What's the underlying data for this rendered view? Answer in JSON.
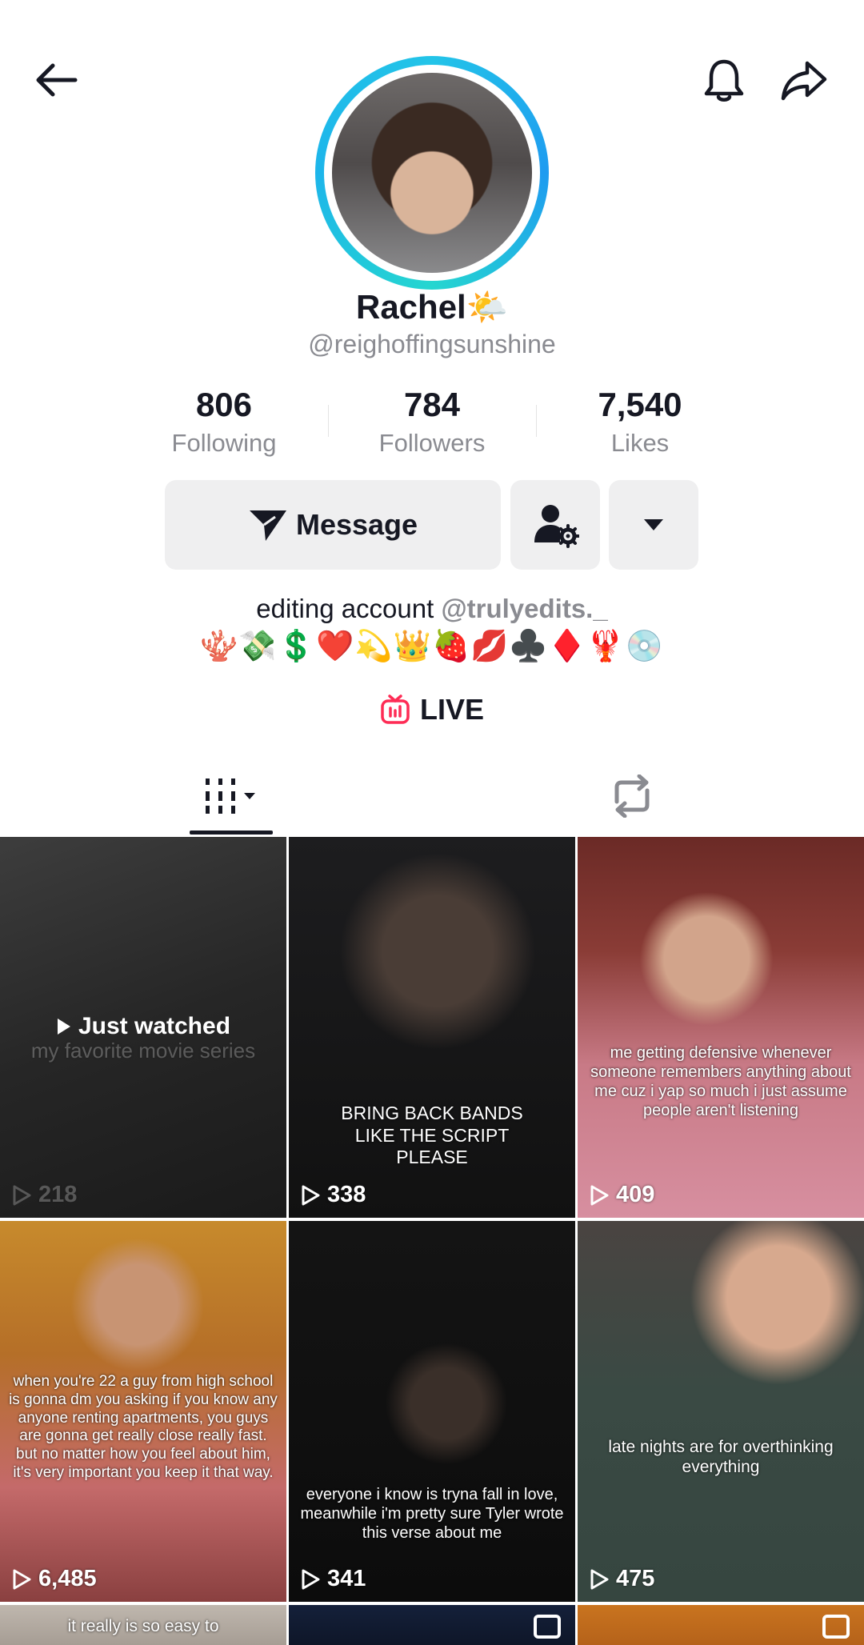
{
  "profile": {
    "name": "Rachel",
    "name_emoji": "🌤️",
    "handle": "@reighoffingsunshine"
  },
  "stats": [
    {
      "value": "806",
      "label": "Following"
    },
    {
      "value": "784",
      "label": "Followers"
    },
    {
      "value": "7,540",
      "label": "Likes"
    }
  ],
  "actions": {
    "message_label": "Message"
  },
  "bio": {
    "text": "editing account ",
    "mention": "@trulyedits._",
    "emojis": "🪸💸💲❤️💫👑🍓💋♣️♦️🦞💿"
  },
  "live": {
    "label": "LIVE"
  },
  "tabs": {
    "videos_icon": "grid-icon",
    "reposts_icon": "repost-icon"
  },
  "videos": [
    {
      "views": "218",
      "overlay": "Just watched",
      "caption": "my favorite movie series"
    },
    {
      "views": "338",
      "caption": "BRING BACK BANDS LIKE THE SCRIPT PLEASE"
    },
    {
      "views": "409",
      "caption": "me getting defensive whenever someone remembers anything about me cuz i yap so much i just assume people aren't listening"
    },
    {
      "views": "6,485",
      "caption": "when you're 22 a guy from high school is gonna dm you asking if you know any anyone renting apartments, you guys are gonna get really close really fast. but no matter how you feel about him, it's very important you keep it that way."
    },
    {
      "views": "341",
      "caption": "everyone i know is tryna fall in love, meanwhile i'm pretty sure Tyler wrote this verse about me"
    },
    {
      "views": "475",
      "caption": "late nights are for overthinking everything"
    },
    {
      "caption": "it really is so easy to"
    }
  ],
  "colors": {
    "accent_live": "#fe2c55",
    "ring": "#23c4e8",
    "muted": "#8a8b91",
    "button_bg": "#efeff0"
  }
}
